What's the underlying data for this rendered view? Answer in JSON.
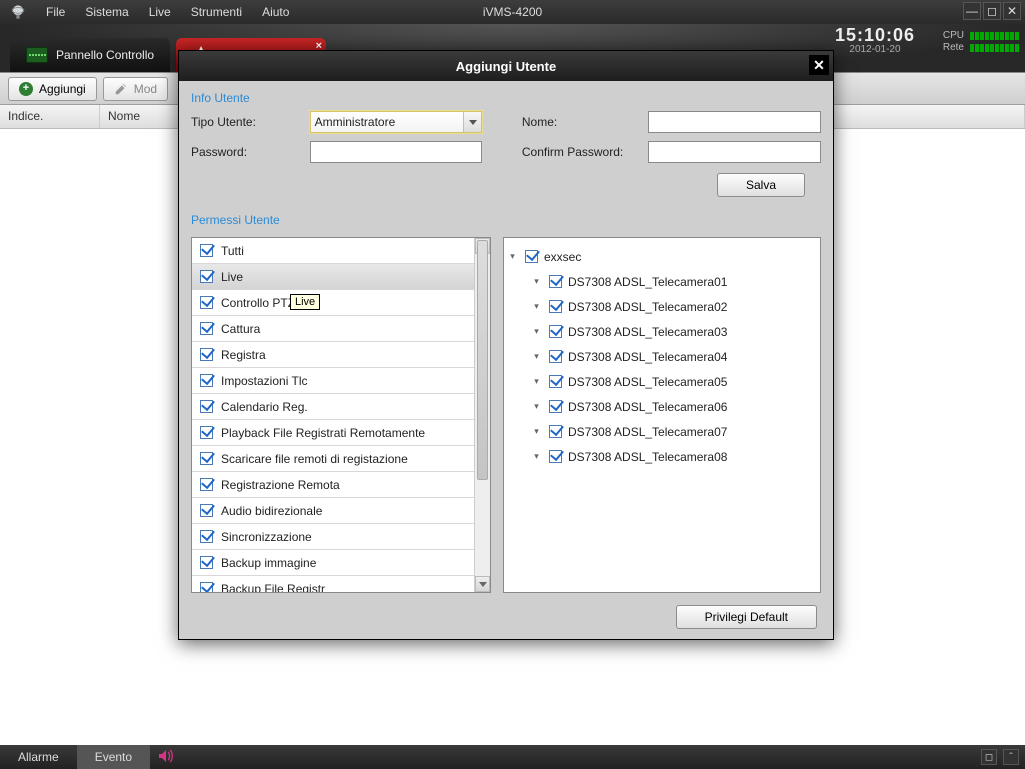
{
  "menu": {
    "items": [
      "File",
      "Sistema",
      "Live",
      "Strumenti",
      "Aiuto"
    ],
    "app_title": "iVMS-4200"
  },
  "window_controls": {
    "tips": [
      "minimize",
      "maximize",
      "close"
    ]
  },
  "tabs": {
    "active_label": "Pannello Controllo"
  },
  "clock": {
    "time": "15:10:06",
    "date": "2012-01-20"
  },
  "sys": {
    "labels": [
      "CPU",
      "Rete"
    ]
  },
  "toolbar": {
    "add_label": "Aggiungi",
    "mod_label": "Mod"
  },
  "list": {
    "col_index": "Indice.",
    "col_name": "Nome"
  },
  "bottom": {
    "tab_allarme": "Allarme",
    "tab_evento": "Evento"
  },
  "dialog": {
    "title": "Aggiungi Utente",
    "section_info": "Info Utente",
    "section_perm": "Permessi Utente",
    "type_label": "Tipo Utente:",
    "type_value": "Amministratore",
    "name_label": "Nome:",
    "pwd_label": "Password:",
    "cpwd_label": "Confirm Password:",
    "save_label": "Salva",
    "default_label": "Privilegi Default",
    "tooltip": "Live",
    "perms": [
      "Tutti",
      "Live",
      "Controllo PTZ",
      "Cattura",
      "Registra",
      "Impostazioni Tlc",
      "Calendario Reg.",
      "Playback File Registrati Remotamente",
      "Scaricare file remoti di registazione",
      "Registrazione Remota",
      "Audio bidirezionale",
      "Sincronizzazione",
      "Backup immagine",
      "Backup File Registr"
    ],
    "tree_root": "exxsec",
    "cameras": [
      "DS7308 ADSL_Telecamera01",
      "DS7308 ADSL_Telecamera02",
      "DS7308 ADSL_Telecamera03",
      "DS7308 ADSL_Telecamera04",
      "DS7308 ADSL_Telecamera05",
      "DS7308 ADSL_Telecamera06",
      "DS7308 ADSL_Telecamera07",
      "DS7308 ADSL_Telecamera08"
    ]
  }
}
